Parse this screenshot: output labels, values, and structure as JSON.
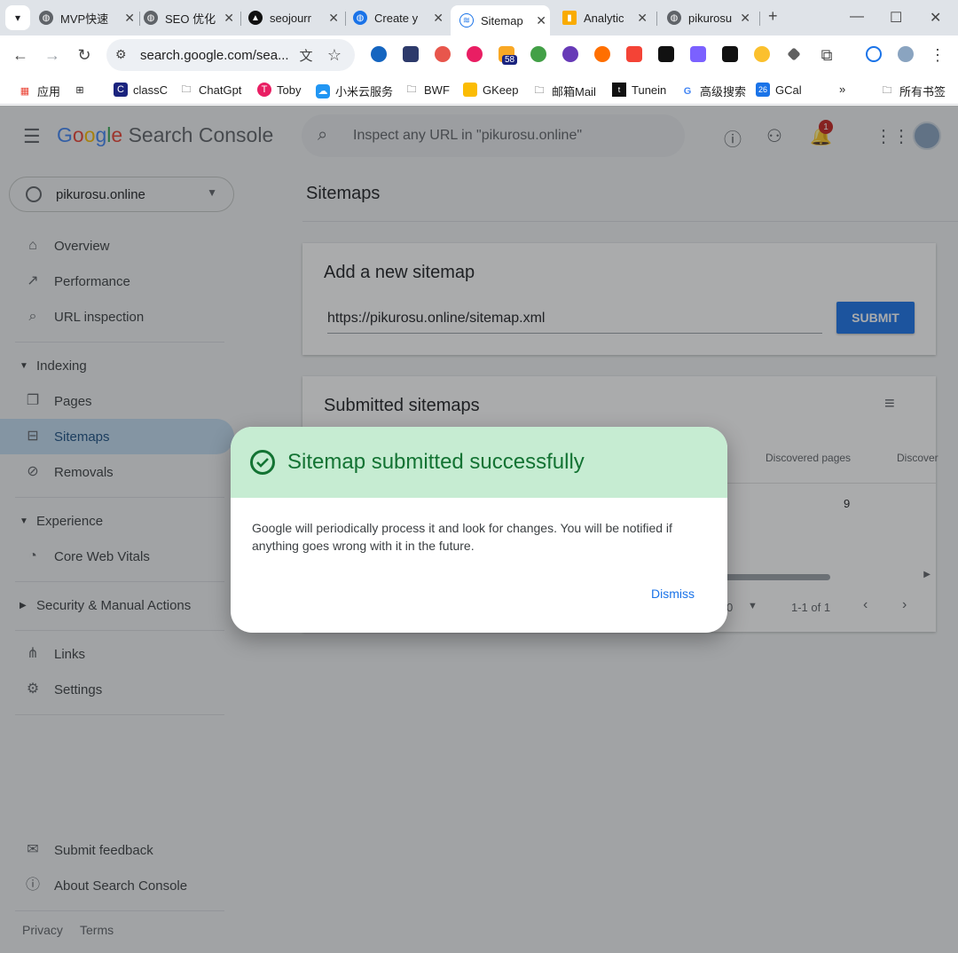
{
  "browser": {
    "tabs": [
      {
        "label": "MVP快速",
        "icon": "globe-icon"
      },
      {
        "label": "SEO 优化",
        "icon": "globe-icon"
      },
      {
        "label": "seojourr",
        "icon": "triangle-icon"
      },
      {
        "label": "Create y",
        "icon": "globe-icon"
      },
      {
        "label": "Sitemap",
        "icon": "search-console-icon"
      },
      {
        "label": "Analytic",
        "icon": "analytics-icon"
      },
      {
        "label": "pikurosu",
        "icon": "globe-icon"
      }
    ],
    "address": "search.google.com/sea...",
    "extension_badge": "58",
    "bookmarks": [
      "应用",
      "classC",
      "ChatGpt",
      "Toby",
      "小米云服务",
      "BWF",
      "GKeep",
      "邮箱Mail",
      "Tunein",
      "高级搜索",
      "GCal",
      "所有书签"
    ],
    "colors": {
      "tabstrip": "#dfe3e8",
      "omnibox": "#edf0f4"
    }
  },
  "app": {
    "product": {
      "google": "Google",
      "rest": " Search Console"
    },
    "inspect_placeholder": "Inspect any URL in \"pikurosu.online\"",
    "notification_count": "1",
    "property": "pikurosu.online",
    "nav": {
      "overview": "Overview",
      "performance": "Performance",
      "url_inspection": "URL inspection",
      "indexing": "Indexing",
      "pages": "Pages",
      "sitemaps": "Sitemaps",
      "removals": "Removals",
      "experience": "Experience",
      "core_web_vitals": "Core Web Vitals",
      "security": "Security & Manual Actions",
      "links": "Links",
      "settings": "Settings",
      "feedback": "Submit feedback",
      "about": "About Search Console",
      "privacy": "Privacy",
      "terms": "Terms"
    },
    "page_title": "Sitemaps",
    "add_sitemap": {
      "title": "Add a new sitemap",
      "url_value": "https://pikurosu.online/sitemap.xml",
      "submit": "SUBMIT"
    },
    "submitted": {
      "title": "Submitted sitemaps",
      "columns": [
        "Discovered pages",
        "Discover"
      ],
      "discovered_pages": "9",
      "rows_per_page": "0",
      "range": "1-1 of 1"
    },
    "colors": {
      "accent": "#1a73e8",
      "active_nav": "#c2dbf0",
      "success_bg": "#c6ecd2",
      "success_text": "#137333"
    }
  },
  "dialog": {
    "title": "Sitemap submitted successfully",
    "body": "Google will periodically process it and look for changes. You will be notified if anything goes wrong with it in the future.",
    "dismiss": "Dismiss"
  }
}
